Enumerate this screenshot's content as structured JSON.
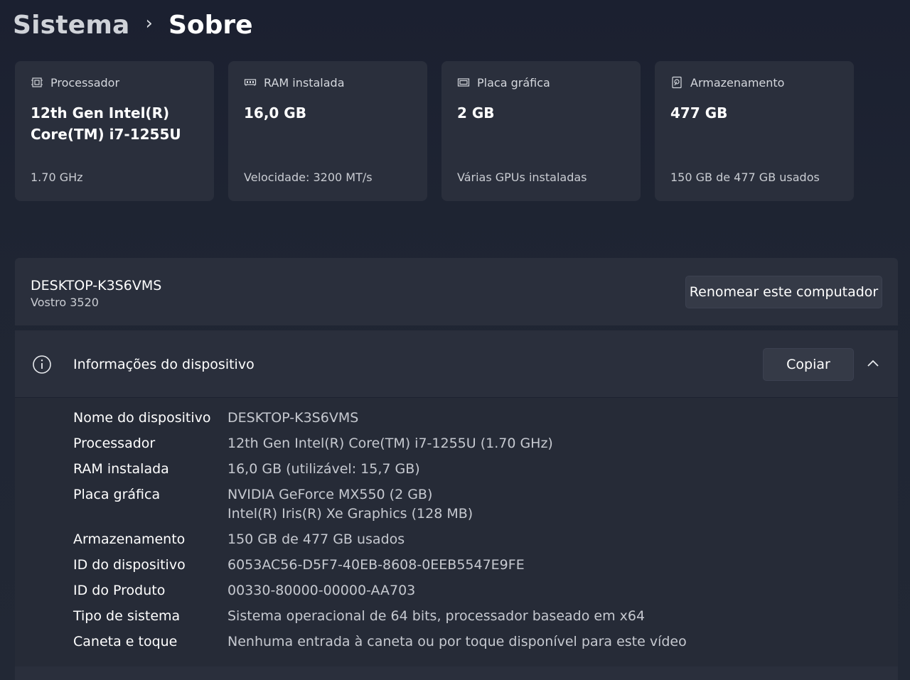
{
  "breadcrumb": {
    "parent": "Sistema",
    "separator": "›",
    "current": "Sobre"
  },
  "cards": [
    {
      "icon": "processor-icon",
      "title": "Processador",
      "value": "12th Gen Intel(R) Core(TM) i7-1255U",
      "sub": "1.70 GHz"
    },
    {
      "icon": "ram-icon",
      "title": "RAM instalada",
      "value": "16,0 GB",
      "sub": "Velocidade: 3200 MT/s"
    },
    {
      "icon": "gpu-icon",
      "title": "Placa gráfica",
      "value": "2 GB",
      "sub": "Várias GPUs instaladas"
    },
    {
      "icon": "storage-icon",
      "title": "Armazenamento",
      "value": "477 GB",
      "sub": "150 GB de 477 GB usados"
    }
  ],
  "computer": {
    "name": "DESKTOP-K3S6VMS",
    "model": "Vostro 3520",
    "rename_label": "Renomear este computador"
  },
  "device_info": {
    "title": "Informações do dispositivo",
    "copy_label": "Copiar",
    "rows": [
      {
        "label": "Nome do dispositivo",
        "values": [
          "DESKTOP-K3S6VMS"
        ]
      },
      {
        "label": "Processador",
        "values": [
          "12th Gen Intel(R) Core(TM) i7-1255U (1.70 GHz)"
        ]
      },
      {
        "label": "RAM instalada",
        "values": [
          "16,0 GB (utilizável: 15,7 GB)"
        ]
      },
      {
        "label": "Placa gráfica",
        "values": [
          "NVIDIA GeForce MX550 (2 GB)",
          "Intel(R) Iris(R) Xe Graphics (128 MB)"
        ]
      },
      {
        "label": "Armazenamento",
        "values": [
          "150 GB de 477 GB usados"
        ]
      },
      {
        "label": "ID do dispositivo",
        "values": [
          "6053AC56-D5F7-40EB-8608-0EEB5547E9FE"
        ]
      },
      {
        "label": "ID do Produto",
        "values": [
          "00330-80000-00000-AA703"
        ]
      },
      {
        "label": "Tipo de sistema",
        "values": [
          "Sistema operacional de 64 bits, processador baseado em x64"
        ]
      },
      {
        "label": "Caneta e toque",
        "values": [
          "Nenhuma entrada à caneta ou por toque disponível para este vídeo"
        ]
      }
    ]
  }
}
